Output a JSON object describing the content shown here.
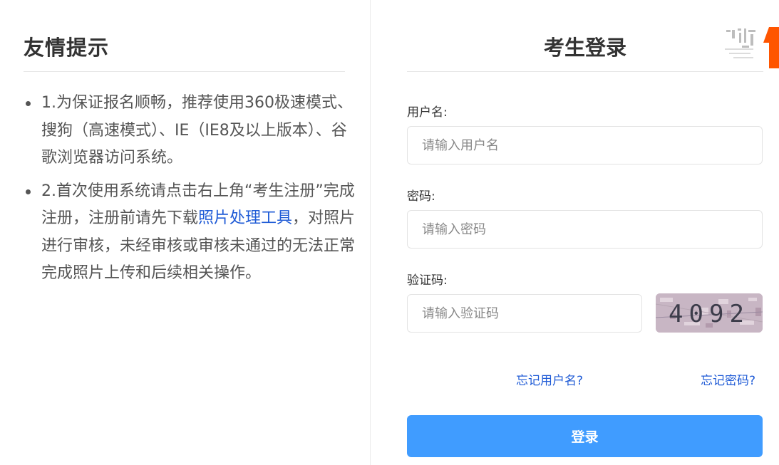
{
  "tips_panel": {
    "title": "友情提示",
    "items": [
      {
        "text": "1.为保证报名顺畅，推荐使用360极速模式、搜狗（高速模式）、IE（IE8及以上版本）、谷歌浏览器访问系统。"
      },
      {
        "text_before_link": "2.首次使用系统请点击右上角“考生注册”完成注册，注册前请先下载",
        "link_text": "照片处理工具",
        "text_after_link": "，对照片进行审核，未经审核或审核未通过的无法正常完成照片上传和后续相关操作。"
      }
    ]
  },
  "login_panel": {
    "title": "考生登录",
    "username": {
      "label": "用户名:",
      "placeholder": "请输入用户名",
      "value": ""
    },
    "password": {
      "label": "密码:",
      "placeholder": "请输入密码",
      "value": ""
    },
    "captcha": {
      "label": "验证码:",
      "placeholder": "请输入验证码",
      "value": "",
      "image_text": "4092"
    },
    "forgot_username": "忘记用户名?",
    "forgot_password": "忘记密码?",
    "login_button": "登录"
  },
  "colors": {
    "accent": "#409cff",
    "link": "#1f5bd6",
    "corner_orange": "#ff5500"
  }
}
